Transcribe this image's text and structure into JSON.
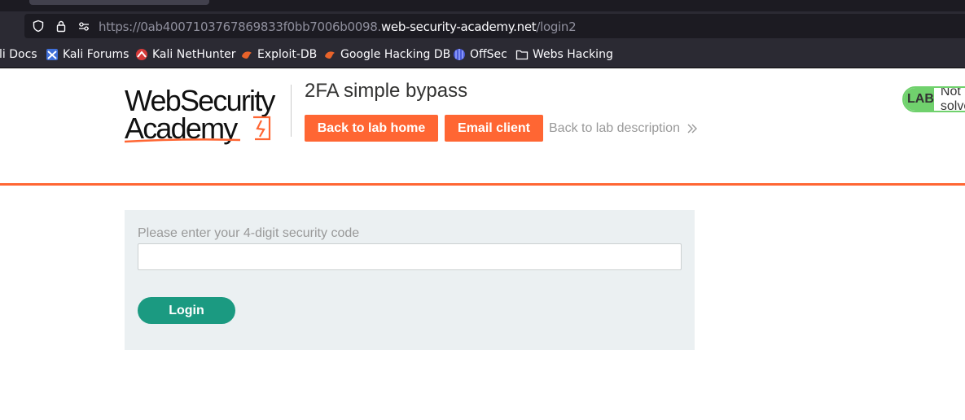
{
  "browser": {
    "url_prefix": "https://0ab4007103767869833f0bb7006b0098.",
    "url_domain": "web-security-academy.net",
    "url_path": "/login2",
    "bookmarks": [
      {
        "label": "li Docs",
        "icon": "kali-docs-icon"
      },
      {
        "label": "Kali Forums",
        "icon": "kali-forums-icon"
      },
      {
        "label": "Kali NetHunter",
        "icon": "kali-nethunter-icon"
      },
      {
        "label": "Exploit-DB",
        "icon": "exploit-db-icon"
      },
      {
        "label": "Google Hacking DB",
        "icon": "ghdb-icon"
      },
      {
        "label": "OffSec",
        "icon": "offsec-icon"
      },
      {
        "label": "Webs Hacking",
        "icon": "folder-icon"
      }
    ]
  },
  "header": {
    "logo_line1": "WebSecurity",
    "logo_line2": "Academy",
    "lab_title": "2FA simple bypass",
    "back_to_lab_home": "Back to lab home",
    "email_client": "Email client",
    "back_to_lab_description": "Back to lab description",
    "lab_badge_label": "LAB",
    "lab_badge_status": "Not solved"
  },
  "form": {
    "label": "Please enter your 4-digit security code",
    "code_value": "",
    "login_label": "Login"
  },
  "colors": {
    "accent_orange": "#ff6633",
    "login_green": "#1b9a81",
    "badge_green": "#70d16d",
    "panel_bg": "#ebf0f2"
  }
}
